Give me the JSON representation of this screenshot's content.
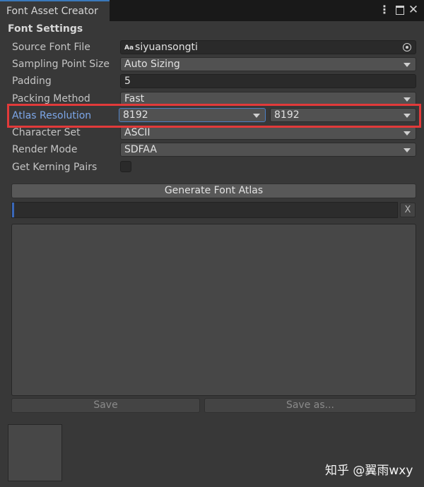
{
  "window": {
    "tab_title": "Font Asset Creator",
    "controls": {
      "menu": "⋮",
      "close": "✕"
    }
  },
  "settings": {
    "section_title": "Font Settings",
    "source_font_file": {
      "label": "Source Font File",
      "value": "siyuansongti",
      "icon": "font-asset-icon",
      "picker_icon": "object-picker-icon"
    },
    "sampling_point_size": {
      "label": "Sampling Point Size",
      "value": "Auto Sizing"
    },
    "padding": {
      "label": "Padding",
      "value": "5"
    },
    "packing_method": {
      "label": "Packing Method",
      "value": "Fast"
    },
    "atlas_resolution": {
      "label": "Atlas Resolution",
      "width": "8192",
      "height": "8192"
    },
    "character_set": {
      "label": "Character Set",
      "value": "ASCII"
    },
    "render_mode": {
      "label": "Render Mode",
      "value": "SDFAA"
    },
    "get_kerning_pairs": {
      "label": "Get Kerning Pairs",
      "checked": false
    }
  },
  "actions": {
    "generate_label": "Generate Font Atlas",
    "progress_percent": 0,
    "clear_label": "X",
    "save_label": "Save",
    "save_as_label": "Save as..."
  },
  "watermark": "知乎 @翼雨wxy",
  "colors": {
    "highlight_box": "#e23a3a",
    "active_label": "#7ca6e8",
    "tab_accent": "#3a79bb"
  }
}
